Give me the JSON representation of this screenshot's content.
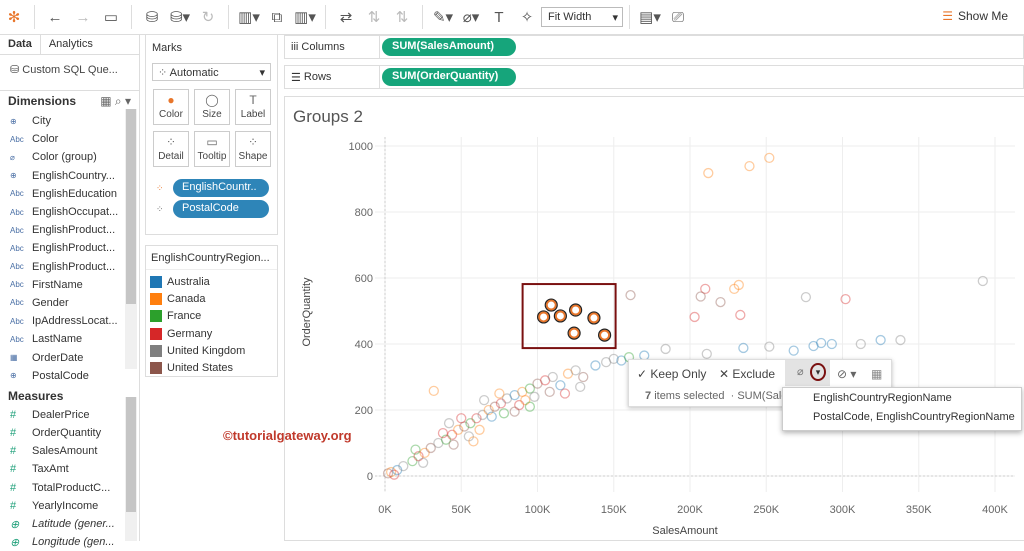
{
  "toolbar": {
    "fit": "Fit Width",
    "show_me": "Show Me"
  },
  "left": {
    "tab_data": "Data",
    "tab_analytics": "Analytics",
    "source": "Custom SQL Que...",
    "dimensions_title": "Dimensions",
    "measures_title": "Measures",
    "dimensions": [
      {
        "type": "globe",
        "name": "City"
      },
      {
        "type": "Abc",
        "name": "Color"
      },
      {
        "type": "clip",
        "name": "Color (group)"
      },
      {
        "type": "globe",
        "name": "EnglishCountry..."
      },
      {
        "type": "Abc",
        "name": "EnglishEducation"
      },
      {
        "type": "Abc",
        "name": "EnglishOccupat..."
      },
      {
        "type": "Abc",
        "name": "EnglishProduct..."
      },
      {
        "type": "Abc",
        "name": "EnglishProduct..."
      },
      {
        "type": "Abc",
        "name": "EnglishProduct..."
      },
      {
        "type": "Abc",
        "name": "FirstName"
      },
      {
        "type": "Abc",
        "name": "Gender"
      },
      {
        "type": "Abc",
        "name": "IpAddressLocat..."
      },
      {
        "type": "Abc",
        "name": "LastName"
      },
      {
        "type": "cal",
        "name": "OrderDate"
      },
      {
        "type": "globe",
        "name": "PostalCode"
      }
    ],
    "measures": [
      {
        "type": "#",
        "name": "DealerPrice"
      },
      {
        "type": "#",
        "name": "OrderQuantity"
      },
      {
        "type": "#",
        "name": "SalesAmount"
      },
      {
        "type": "#",
        "name": "TaxAmt"
      },
      {
        "type": "#",
        "name": "TotalProductC..."
      },
      {
        "type": "#",
        "name": "YearlyIncome"
      },
      {
        "type": "globe",
        "name": "Latitude (gener...",
        "italic": true
      },
      {
        "type": "globe",
        "name": "Longitude (gen...",
        "italic": true
      }
    ]
  },
  "marks": {
    "title": "Marks",
    "type": "Automatic",
    "buttons": [
      "Color",
      "Size",
      "Label",
      "Detail",
      "Tooltip",
      "Shape"
    ],
    "pills": [
      "EnglishCountr..",
      "PostalCode"
    ]
  },
  "legend": {
    "title": "EnglishCountryRegion...",
    "items": [
      {
        "name": "Australia",
        "color": "#1f77b4"
      },
      {
        "name": "Canada",
        "color": "#ff7f0e"
      },
      {
        "name": "France",
        "color": "#2ca02c"
      },
      {
        "name": "Germany",
        "color": "#d62728"
      },
      {
        "name": "United Kingdom",
        "color": "#7f7f7f"
      },
      {
        "name": "United States",
        "color": "#8c564b"
      }
    ]
  },
  "shelves": {
    "columns_label": "Columns",
    "columns_pill": "SUM(SalesAmount)",
    "rows_label": "Rows",
    "rows_pill": "SUM(OrderQuantity)"
  },
  "view": {
    "title": "Groups 2",
    "watermark": "©tutorialgateway.org"
  },
  "tooltip": {
    "keep_only": "Keep Only",
    "exclude": "Exclude",
    "count": "7",
    "selected_text": "items selected",
    "summary": "· SUM(Sale"
  },
  "group_menu": [
    "EnglishCountryRegionName",
    "PostalCode, EnglishCountryRegionName"
  ],
  "chart_data": {
    "type": "scatter",
    "xlabel": "SalesAmount",
    "ylabel": "OrderQuantity",
    "xlim": [
      0,
      400000
    ],
    "ylim": [
      0,
      1000
    ],
    "xticks": [
      "0K",
      "50K",
      "100K",
      "150K",
      "200K",
      "250K",
      "300K",
      "350K",
      "400K"
    ],
    "xtick_values": [
      0,
      50000,
      100000,
      150000,
      200000,
      250000,
      300000,
      350000,
      400000
    ],
    "yticks": [
      "0",
      "200",
      "400",
      "600",
      "800",
      "1000"
    ],
    "ytick_values": [
      0,
      200,
      400,
      600,
      800,
      1000
    ],
    "selected": [
      [
        109000,
        518
      ],
      [
        104000,
        482
      ],
      [
        115000,
        485
      ],
      [
        125000,
        503
      ],
      [
        124000,
        433
      ],
      [
        137000,
        479
      ],
      [
        144000,
        427
      ]
    ],
    "points": [
      [
        212000,
        918,
        1
      ],
      [
        239000,
        939,
        1
      ],
      [
        252000,
        964,
        1
      ],
      [
        392000,
        591,
        4
      ],
      [
        161000,
        548,
        5
      ],
      [
        232000,
        579,
        1
      ],
      [
        210000,
        567,
        3
      ],
      [
        229000,
        567,
        1
      ],
      [
        207000,
        544,
        5
      ],
      [
        276000,
        542,
        4
      ],
      [
        302000,
        536,
        3
      ],
      [
        203000,
        482,
        3
      ],
      [
        233000,
        488,
        3
      ],
      [
        220000,
        527,
        5
      ],
      [
        325000,
        412,
        0
      ],
      [
        338000,
        412,
        4
      ],
      [
        312000,
        400,
        4
      ],
      [
        281000,
        394,
        0
      ],
      [
        286000,
        403,
        0
      ],
      [
        293000,
        400,
        0
      ],
      [
        211000,
        370,
        4
      ],
      [
        184000,
        385,
        4
      ],
      [
        235000,
        388,
        0
      ],
      [
        252000,
        392,
        4
      ],
      [
        268000,
        380,
        0
      ],
      [
        150000,
        355,
        4
      ],
      [
        32000,
        258,
        1
      ],
      [
        2000,
        8,
        5
      ],
      [
        4000,
        12,
        1
      ],
      [
        6000,
        4,
        3
      ],
      [
        8000,
        18,
        0
      ],
      [
        12000,
        30,
        4
      ],
      [
        18000,
        45,
        2
      ],
      [
        22000,
        60,
        3
      ],
      [
        26000,
        70,
        1
      ],
      [
        30000,
        85,
        5
      ],
      [
        35000,
        100,
        4
      ],
      [
        40000,
        110,
        2
      ],
      [
        44000,
        125,
        3
      ],
      [
        48000,
        140,
        1
      ],
      [
        52000,
        150,
        5
      ],
      [
        56000,
        160,
        2
      ],
      [
        60000,
        175,
        3
      ],
      [
        64000,
        185,
        4
      ],
      [
        68000,
        200,
        1
      ],
      [
        72000,
        210,
        5
      ],
      [
        76000,
        220,
        3
      ],
      [
        80000,
        235,
        4
      ],
      [
        85000,
        245,
        0
      ],
      [
        90000,
        255,
        1
      ],
      [
        95000,
        265,
        2
      ],
      [
        100000,
        280,
        5
      ],
      [
        105000,
        290,
        3
      ],
      [
        110000,
        300,
        4
      ],
      [
        115000,
        275,
        0
      ],
      [
        120000,
        310,
        1
      ],
      [
        125000,
        320,
        4
      ],
      [
        130000,
        300,
        5
      ],
      [
        138000,
        335,
        0
      ],
      [
        145000,
        345,
        4
      ],
      [
        155000,
        350,
        0
      ],
      [
        160000,
        360,
        2
      ],
      [
        170000,
        365,
        0
      ],
      [
        25000,
        40,
        4
      ],
      [
        38000,
        130,
        3
      ],
      [
        45000,
        95,
        5
      ],
      [
        55000,
        120,
        4
      ],
      [
        62000,
        140,
        1
      ],
      [
        70000,
        180,
        0
      ],
      [
        78000,
        190,
        2
      ],
      [
        88000,
        215,
        3
      ],
      [
        92000,
        230,
        1
      ],
      [
        98000,
        240,
        4
      ],
      [
        108000,
        255,
        5
      ],
      [
        118000,
        250,
        3
      ],
      [
        128000,
        270,
        4
      ],
      [
        65000,
        230,
        4
      ],
      [
        75000,
        250,
        1
      ],
      [
        85000,
        195,
        5
      ],
      [
        95000,
        210,
        2
      ],
      [
        42000,
        160,
        4
      ],
      [
        50000,
        175,
        3
      ],
      [
        58000,
        105,
        1
      ],
      [
        20000,
        80,
        2
      ]
    ]
  }
}
